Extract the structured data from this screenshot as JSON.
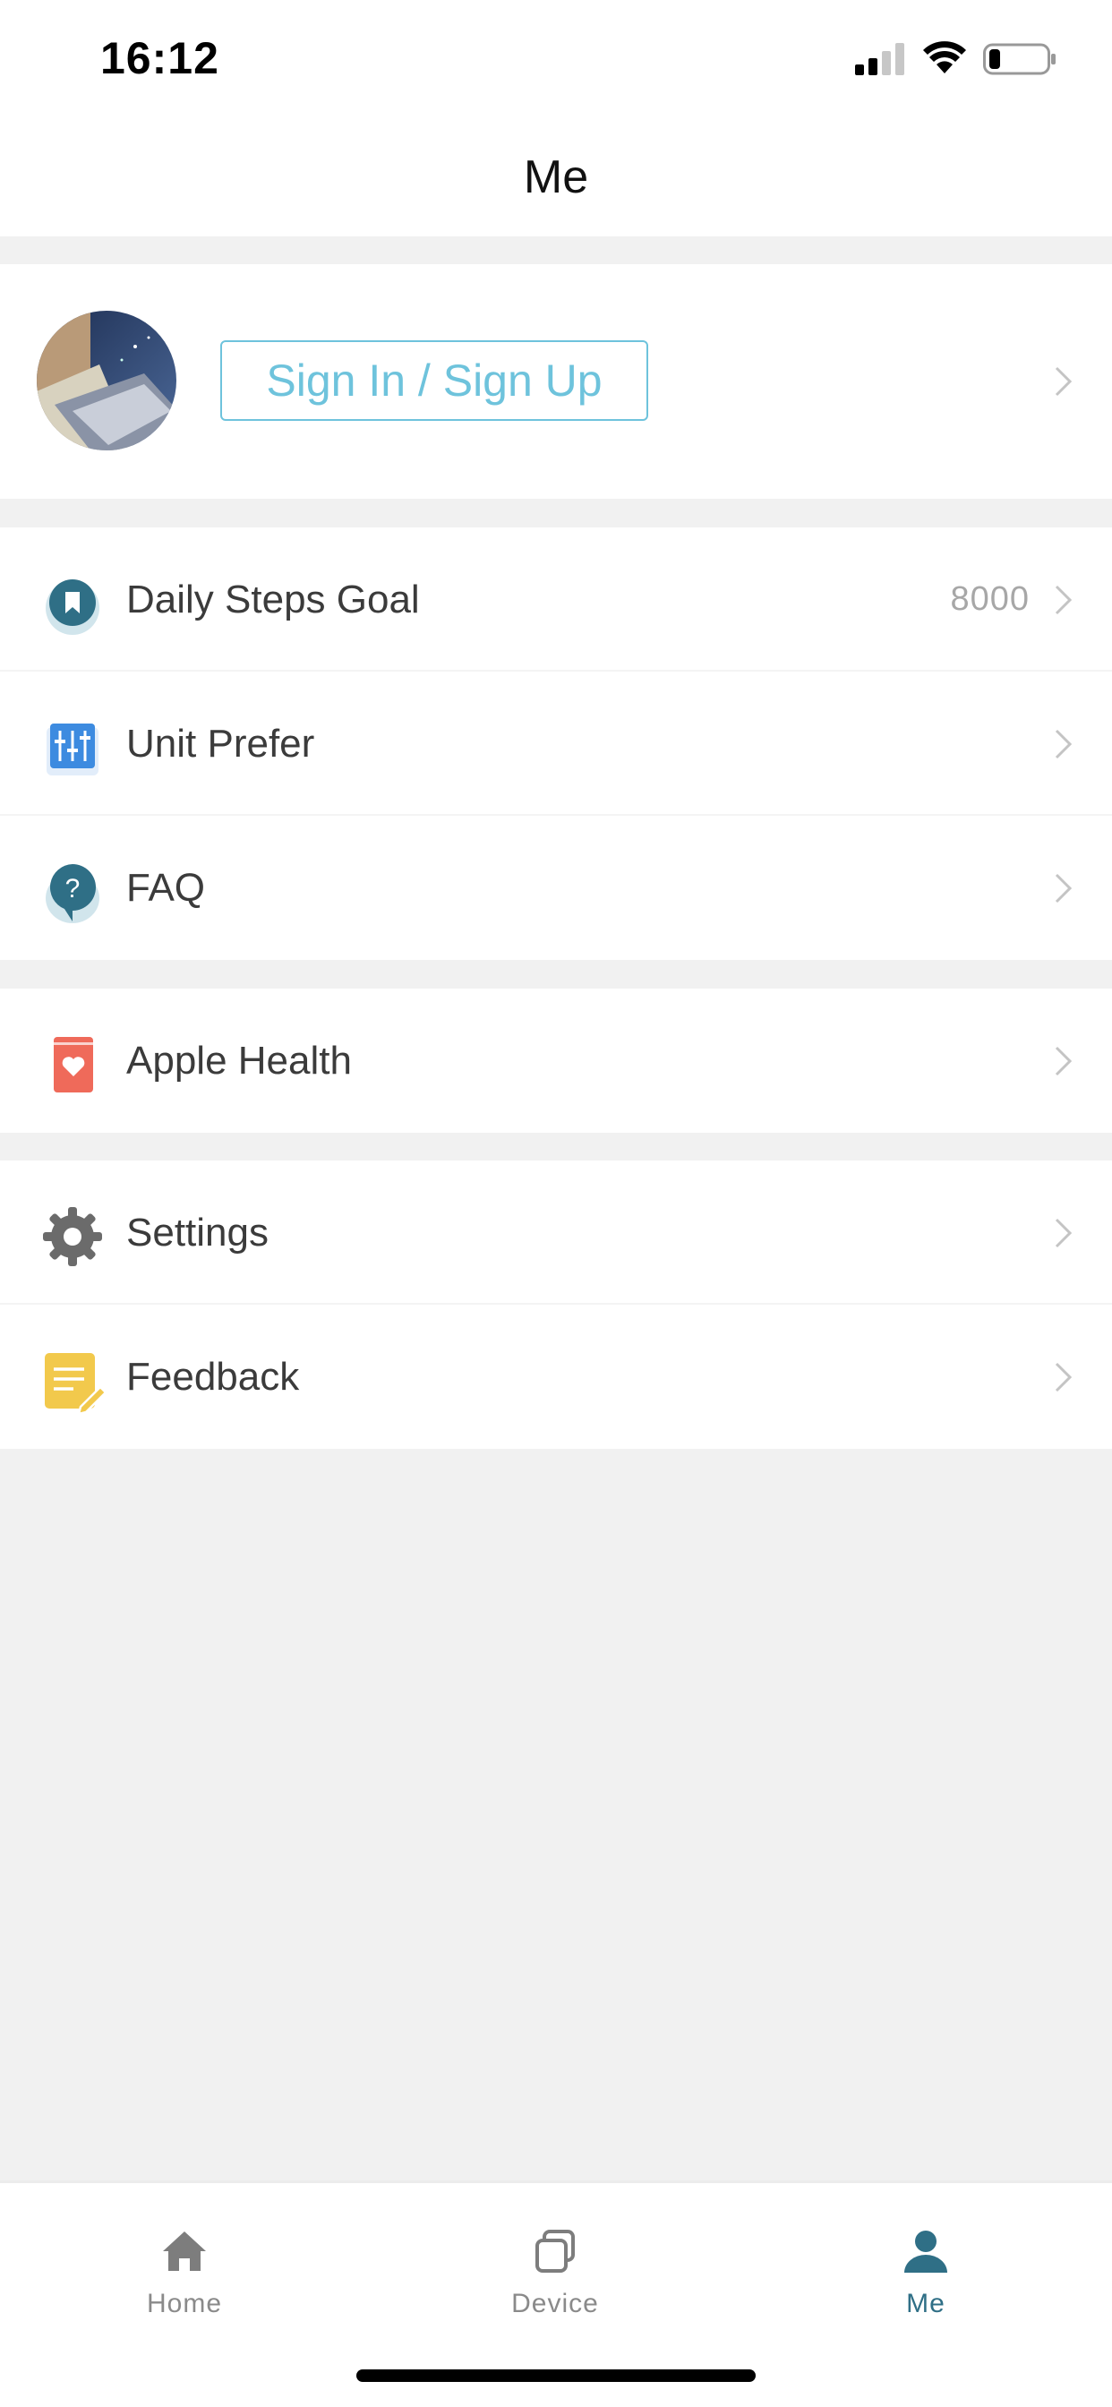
{
  "status_bar": {
    "time": "16:12"
  },
  "nav": {
    "title": "Me"
  },
  "profile": {
    "signin_label": "Sign In / Sign Up"
  },
  "menu": {
    "group1": [
      {
        "label": "Daily Steps Goal",
        "value": "8000",
        "icon": "bookmark-icon"
      },
      {
        "label": "Unit Prefer",
        "icon": "sliders-icon"
      },
      {
        "label": "FAQ",
        "icon": "question-icon"
      }
    ],
    "group2": [
      {
        "label": "Apple Health",
        "icon": "heart-icon"
      }
    ],
    "group3": [
      {
        "label": "Settings",
        "icon": "gear-icon"
      },
      {
        "label": "Feedback",
        "icon": "feedback-icon"
      }
    ]
  },
  "tabs": [
    {
      "label": "Home",
      "icon": "home-icon"
    },
    {
      "label": "Device",
      "icon": "device-icon"
    },
    {
      "label": "Me",
      "icon": "person-icon",
      "active": true
    }
  ],
  "colors": {
    "accent": "#6ec3dc",
    "active_tab": "#2f6f86",
    "background": "#f1f1f1"
  }
}
